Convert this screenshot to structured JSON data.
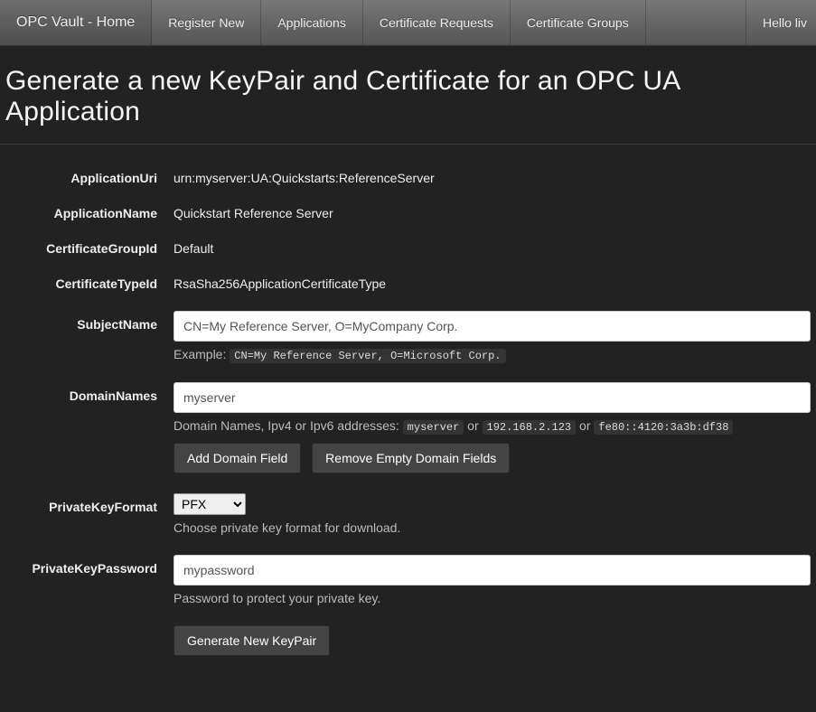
{
  "nav": {
    "brand": "OPC Vault - Home",
    "items": [
      "Register New",
      "Applications",
      "Certificate Requests",
      "Certificate Groups"
    ],
    "greeting": "Hello liv"
  },
  "page": {
    "title": "Generate a new KeyPair and Certificate for an OPC UA Application"
  },
  "form": {
    "applicationUri": {
      "label": "ApplicationUri",
      "value": "urn:myserver:UA:Quickstarts:ReferenceServer"
    },
    "applicationName": {
      "label": "ApplicationName",
      "value": "Quickstart Reference Server"
    },
    "certificateGroupId": {
      "label": "CertificateGroupId",
      "value": "Default"
    },
    "certificateTypeId": {
      "label": "CertificateTypeId",
      "value": "RsaSha256ApplicationCertificateType"
    },
    "subjectName": {
      "label": "SubjectName",
      "value": "CN=My Reference Server, O=MyCompany Corp.",
      "examplePrefix": "Example: ",
      "example": "CN=My Reference Server, O=Microsoft Corp."
    },
    "domainNames": {
      "label": "DomainNames",
      "value": "myserver",
      "helpPrefix": "Domain Names, Ipv4 or Ipv6 addresses: ",
      "ex1": "myserver",
      "or": " or ",
      "ex2": "192.168.2.123",
      "ex3": "fe80::4120:3a3b:df38",
      "addBtn": "Add Domain Field",
      "removeBtn": "Remove Empty Domain Fields"
    },
    "privateKeyFormat": {
      "label": "PrivateKeyFormat",
      "value": "PFX",
      "help": "Choose private key format for download."
    },
    "privateKeyPassword": {
      "label": "PrivateKeyPassword",
      "value": "mypassword",
      "help": "Password to protect your private key."
    },
    "submit": "Generate New KeyPair"
  }
}
